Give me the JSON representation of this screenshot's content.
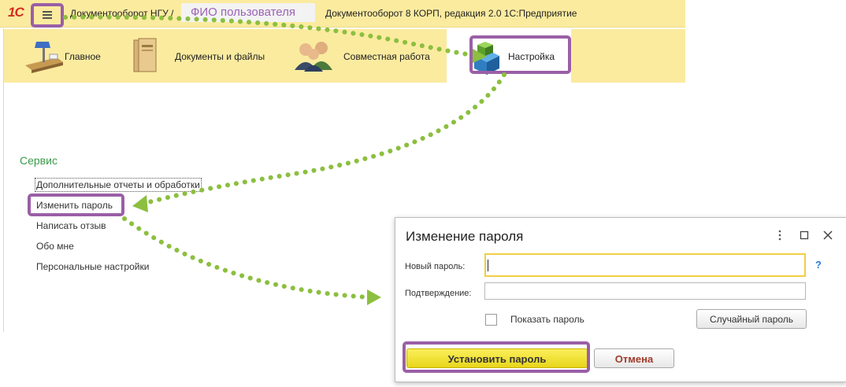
{
  "app": {
    "logo": "1С",
    "title_left": "Документооборот НГУ /",
    "user_name": "ФИО пользователя",
    "title_right": "Документооборот 8 КОРП, редакция 2.0 1С:Предприятие"
  },
  "sections": [
    {
      "label": "Главное",
      "icon": "desk-lamp-icon"
    },
    {
      "label": "Документы и файлы",
      "icon": "folders-icon"
    },
    {
      "label": "Совместная работа",
      "icon": "people-icon"
    },
    {
      "label": "Настройка",
      "icon": "cubes-icon",
      "active": true
    }
  ],
  "sidebar": {
    "group_title": "Сервис",
    "commands": [
      "Дополнительные отчеты и обработки",
      "Изменить пароль",
      "Написать отзыв",
      "Обо мне",
      "Персональные настройки"
    ]
  },
  "dialog": {
    "title": "Изменение пароля",
    "new_password_label": "Новый пароль:",
    "new_password_value": "",
    "confirm_label": "Подтверждение:",
    "confirm_value": "",
    "show_password_label": "Показать пароль",
    "show_password_checked": false,
    "random_password_button": "Случайный пароль",
    "help_mark": "?",
    "set_password_button": "Установить пароль",
    "cancel_button": "Отмена"
  },
  "colors": {
    "panel_yellow": "#fbeb9f",
    "highlight_purple": "#9a5fa6",
    "arrow_green": "#8cbf3f",
    "group_green": "#3a9a4a",
    "help_blue": "#2b7bd6",
    "cancel_red": "#a23a2a"
  }
}
